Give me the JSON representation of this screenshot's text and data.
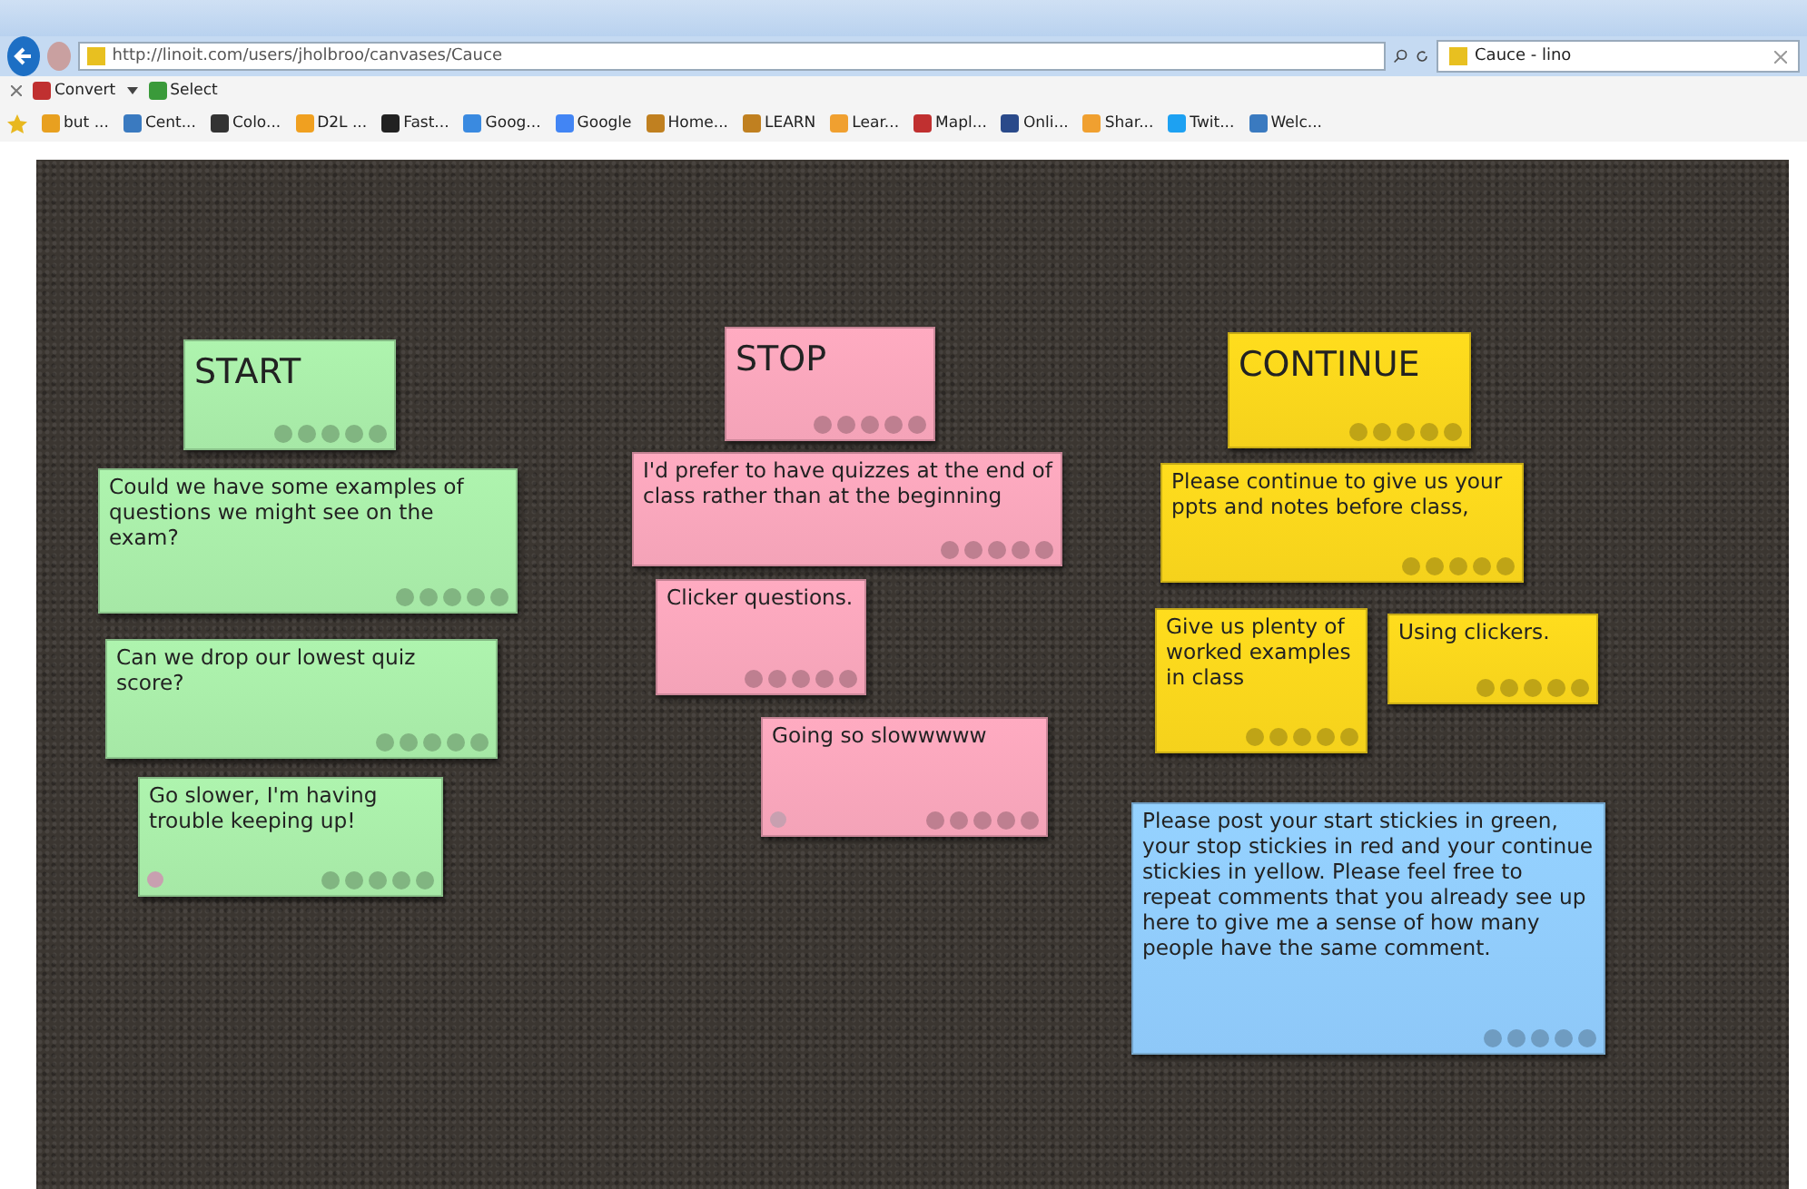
{
  "browser": {
    "url": "http://linoit.com/users/jholbroo/canvases/Cauce",
    "tab": {
      "label": "Cauce - lino",
      "selected": true
    },
    "toolbar": [
      "Convert",
      "Select"
    ],
    "favorites": [
      "but ...",
      "Cent...",
      "Colo...",
      "D2L ...",
      "Fast...",
      "Goog...",
      "Google",
      "Home...",
      "LEARN",
      "Lear...",
      "Mapl...",
      "Onli...",
      "Shar...",
      "Twit...",
      "Welc..."
    ]
  },
  "canvas": {
    "notes": [
      {
        "kind": "heading",
        "text": "START",
        "color": "#a6e8a6",
        "face": false
      },
      {
        "kind": "comment",
        "text": "Could we have some examples of questions we might see on the exam?",
        "color": "#a6e8a6",
        "face": false
      },
      {
        "kind": "comment",
        "text": "Can we drop our lowest quiz score?",
        "color": "#a6e8a6",
        "face": false
      },
      {
        "kind": "comment",
        "text": "Go slower, I'm having trouble keeping up!",
        "color": "#a6e8a6",
        "face": true
      },
      {
        "kind": "heading",
        "text": "STOP",
        "color": "#f4a3b8",
        "face": false
      },
      {
        "kind": "comment",
        "text": "I'd prefer to have quizzes at the end of class rather than at the beginning",
        "color": "#f4a3b8",
        "face": false
      },
      {
        "kind": "comment",
        "text": "Clicker questions.",
        "color": "#f4a3b8",
        "face": false
      },
      {
        "kind": "comment",
        "text": "Going so slowwwww",
        "color": "#f4a3b8",
        "face": true
      },
      {
        "kind": "heading",
        "text": "CONTINUE",
        "color": "#f5d21c",
        "face": false
      },
      {
        "kind": "comment",
        "text": "Please continue to give us your ppts and notes before class,",
        "color": "#f5d21c",
        "face": false
      },
      {
        "kind": "comment",
        "text": "Give us plenty of worked examples in class",
        "color": "#f5d21c",
        "face": false
      },
      {
        "kind": "comment",
        "text": "Using clickers.",
        "color": "#f5d21c",
        "face": false
      },
      {
        "kind": "comment",
        "text": "Please post your start stickies in green, your stop stickies in red and your continue stickies in yellow. Please feel free to repeat comments that you already see up here to give me a sense of how many people have the same comment.",
        "color": "#8ec8f8",
        "face": false
      }
    ]
  }
}
